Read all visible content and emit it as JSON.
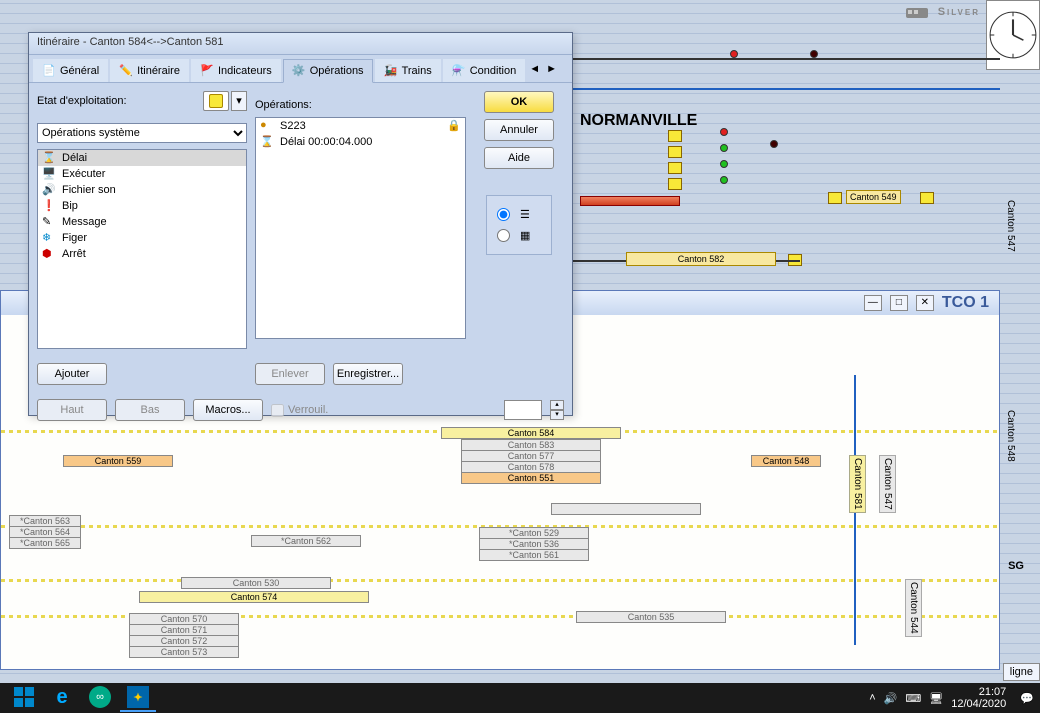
{
  "app_brand": "Silver",
  "dialog": {
    "title": "Itinéraire - Canton 584<-->Canton 581",
    "tabs": [
      "Général",
      "Itinéraire",
      "Indicateurs",
      "Opérations",
      "Trains",
      "Condition"
    ],
    "active_tab": 3,
    "etat_label": "Etat d'exploitation:",
    "combo_label": "Opérations système",
    "operations_col_label": "Opérations:",
    "sys_ops": [
      "Délai",
      "Exécuter",
      "Fichier son",
      "Bip",
      "Message",
      "Figer",
      "Arrêt"
    ],
    "ops_list": [
      {
        "icon": "lock",
        "text": "S223",
        "locked": true
      },
      {
        "icon": "hourglass",
        "text": "Délai 00:00:04.000"
      }
    ],
    "buttons": {
      "ok": "OK",
      "annuler": "Annuler",
      "aide": "Aide",
      "ajouter": "Ajouter",
      "enlever": "Enlever",
      "enregistrer": "Enregistrer...",
      "haut": "Haut",
      "bas": "Bas",
      "macros": "Macros...",
      "verrou": "Verrouil."
    }
  },
  "track": {
    "station": "NORMANVILLE",
    "cantons": {
      "c582": "Canton 582",
      "c549": "Canton 549",
      "c547": "Canton 547",
      "c548": "Canton 548"
    },
    "sg": "SG"
  },
  "tco": {
    "title": "TCO 1",
    "blocks": {
      "c584": "Canton 584",
      "c583": "Canton 583",
      "c577": "Canton 577",
      "c578": "Canton 578",
      "c551": "Canton 551",
      "c559": "Canton 559",
      "c548b": "Canton 548",
      "c563": "*Canton 563",
      "c564": "*Canton 564",
      "c565": "*Canton 565",
      "c562": "*Canton 562",
      "c529": "*Canton 529",
      "c536": "*Canton 536",
      "c561": "*Canton 561",
      "c530": "Canton 530",
      "c574": "Canton 574",
      "c535": "Canton 535",
      "c570": "Canton 570",
      "c571": "Canton 571",
      "c572": "Canton 572",
      "c573": "Canton 573",
      "v547": "Canton 547",
      "v581": "Canton 581",
      "v544": "Canton 544"
    }
  },
  "taskbar": {
    "time": "21:07",
    "date": "12/04/2020"
  },
  "side": {
    "ligne": "ligne"
  }
}
